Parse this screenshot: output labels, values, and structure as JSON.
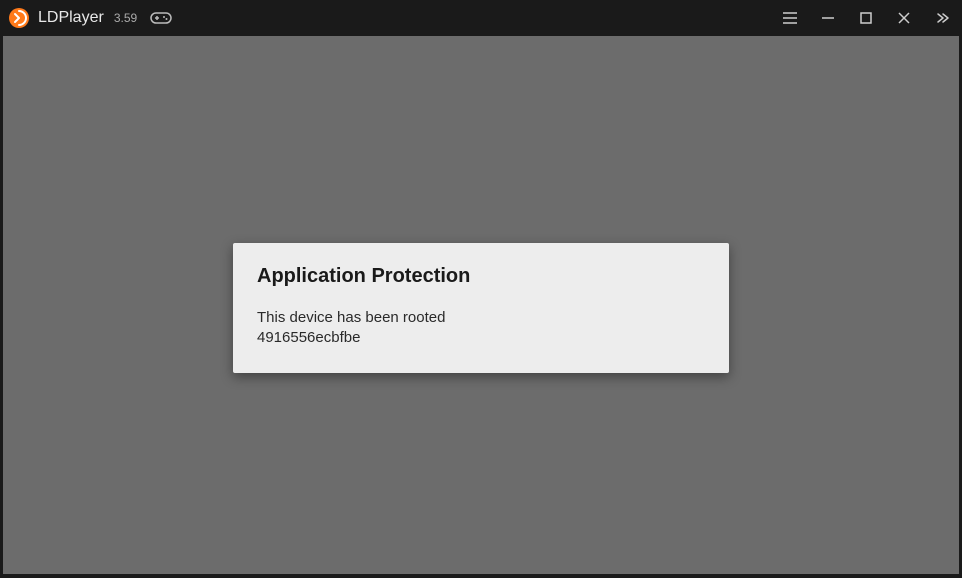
{
  "titlebar": {
    "app_name": "LDPlayer",
    "version": "3.59"
  },
  "dialog": {
    "title": "Application Protection",
    "message_line1": "This device has been rooted",
    "message_line2": "4916556ecbfbe"
  }
}
